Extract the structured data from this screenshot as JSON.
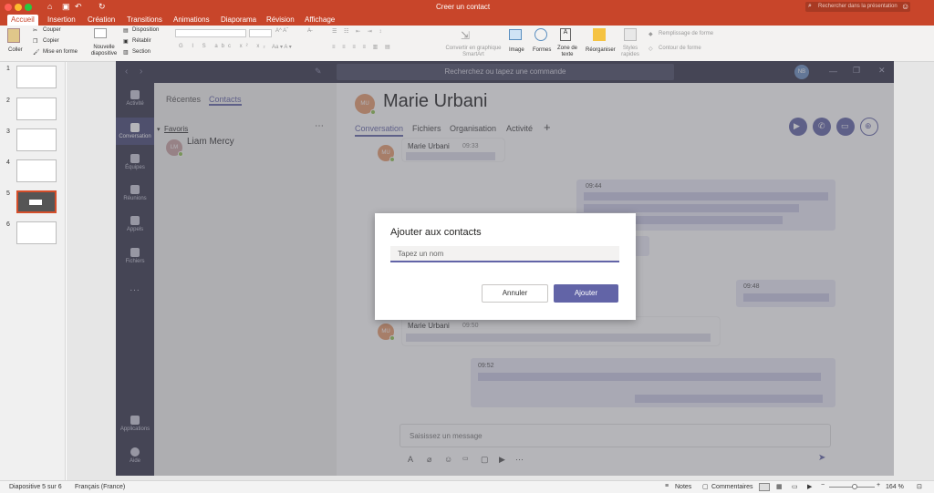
{
  "window": {
    "title": "Creer un contact",
    "search_placeholder": "Rechercher dans la présentation"
  },
  "ribbon_tabs": [
    "Accueil",
    "Insertion",
    "Création",
    "Transitions",
    "Animations",
    "Diaporama",
    "Révision",
    "Affichage"
  ],
  "ribbon": {
    "coller": "Coller",
    "couper": "Couper",
    "copier": "Copier",
    "mise_en_forme": "Mise en forme",
    "nouvelle_diapositive": "Nouvelle diapositive",
    "disposition": "Disposition",
    "retablir": "Rétablir",
    "section": "Section",
    "convertir": "Convertir en graphique SmartArt",
    "image": "Image",
    "formes": "Formes",
    "zone_de_texte": "Zone de texte",
    "reorganiser": "Réorganiser",
    "styles_rapides": "Styles rapides",
    "remplissage": "Remplissage de forme",
    "contour": "Contour de forme"
  },
  "slides": [
    {
      "num": "1"
    },
    {
      "num": "2"
    },
    {
      "num": "3"
    },
    {
      "num": "4"
    },
    {
      "num": "5",
      "selected": true
    },
    {
      "num": "6"
    }
  ],
  "status": {
    "slide_info": "Diapositive 5 sur 6",
    "language": "Français (France)",
    "notes": "Notes",
    "comments": "Commentaires",
    "zoom": "164 %",
    "zoom_level": 0.55
  },
  "teams": {
    "search_placeholder": "Recherchez ou tapez une commande",
    "user_initials": "NB",
    "rail": [
      "Activité",
      "Conversation",
      "Équipes",
      "Réunions",
      "Appels",
      "Fichiers",
      "...",
      "Applications",
      "Aide"
    ],
    "list_tabs": {
      "recent": "Récentes",
      "contacts": "Contacts"
    },
    "favorites_label": "Favoris",
    "contact": {
      "initials": "LM",
      "name": "Liam Mercy"
    },
    "chat": {
      "initials": "MU",
      "name": "Marie Urbani",
      "tabs": [
        "Conversation",
        "Fichiers",
        "Organisation",
        "Activité"
      ],
      "add_tab": "+",
      "messages": [
        {
          "sender": "Marie Urbani",
          "time": "09:33"
        },
        {
          "time": "09:44"
        },
        {
          "time": "09:48"
        },
        {
          "sender": "Marie Urbani",
          "time": "09:50"
        },
        {
          "time": "09:52"
        }
      ],
      "compose_placeholder": "Saisissez un message"
    },
    "dialog": {
      "title": "Ajouter aux contacts",
      "input_placeholder": "Tapez un nom",
      "cancel": "Annuler",
      "add": "Ajouter"
    },
    "accent": "#6264a7",
    "rail_color": "#33344a"
  },
  "colors": {
    "ppt_red": "#c8452a"
  }
}
